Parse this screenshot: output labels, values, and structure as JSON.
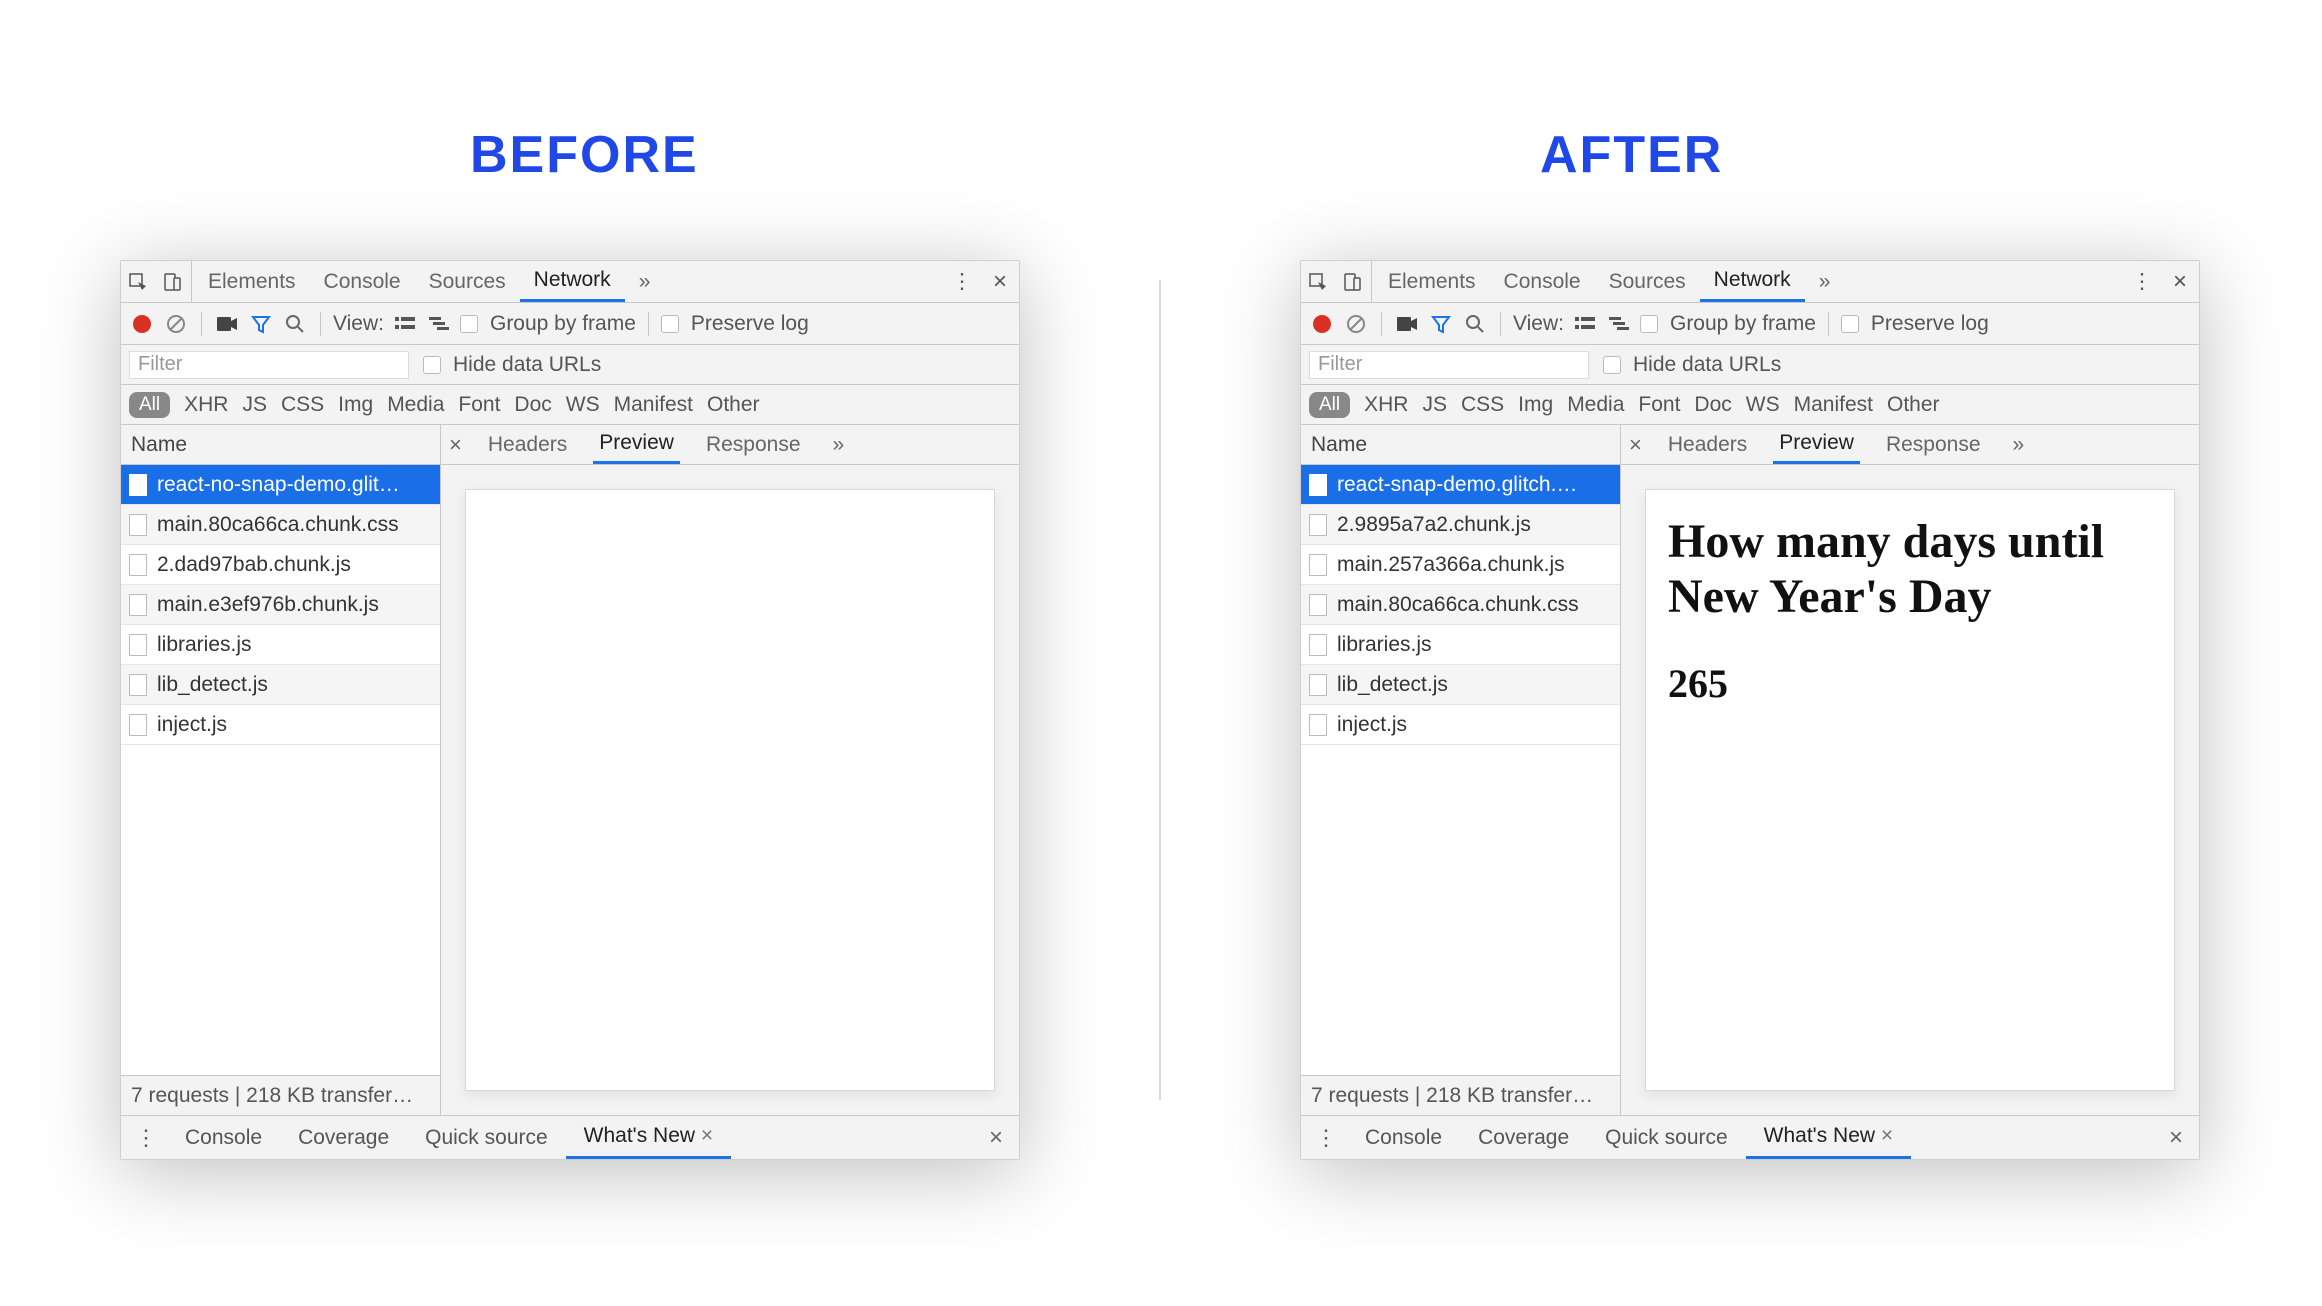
{
  "headings": {
    "before": "BEFORE",
    "after": "AFTER"
  },
  "tabs": {
    "elements": "Elements",
    "console": "Console",
    "sources": "Sources",
    "network": "Network"
  },
  "toolbar": {
    "viewLabel": "View:",
    "groupByFrame": "Group by frame",
    "preserveLog": "Preserve log"
  },
  "filter": {
    "placeholder": "Filter",
    "hideDataUrls": "Hide data URLs"
  },
  "types": {
    "all": "All",
    "xhr": "XHR",
    "js": "JS",
    "css": "CSS",
    "img": "Img",
    "media": "Media",
    "font": "Font",
    "doc": "Doc",
    "ws": "WS",
    "manifest": "Manifest",
    "other": "Other"
  },
  "columns": {
    "name": "Name"
  },
  "subtabs": {
    "headers": "Headers",
    "preview": "Preview",
    "response": "Response"
  },
  "before": {
    "requests": [
      "react-no-snap-demo.glit…",
      "main.80ca66ca.chunk.css",
      "2.dad97bab.chunk.js",
      "main.e3ef976b.chunk.js",
      "libraries.js",
      "lib_detect.js",
      "inject.js"
    ],
    "status": "7 requests | 218 KB transfer…",
    "preview": {
      "title": "",
      "count": ""
    }
  },
  "after": {
    "requests": [
      "react-snap-demo.glitch.…",
      "2.9895a7a2.chunk.js",
      "main.257a366a.chunk.js",
      "main.80ca66ca.chunk.css",
      "libraries.js",
      "lib_detect.js",
      "inject.js"
    ],
    "status": "7 requests | 218 KB transfer…",
    "preview": {
      "title": "How many days until New Year's Day",
      "count": "265"
    }
  },
  "drawer": {
    "console": "Console",
    "coverage": "Coverage",
    "quickSource": "Quick source",
    "whatsNew": "What's New"
  },
  "glyphs": {
    "x": "×",
    "more": "»",
    "dots": "⋮"
  }
}
